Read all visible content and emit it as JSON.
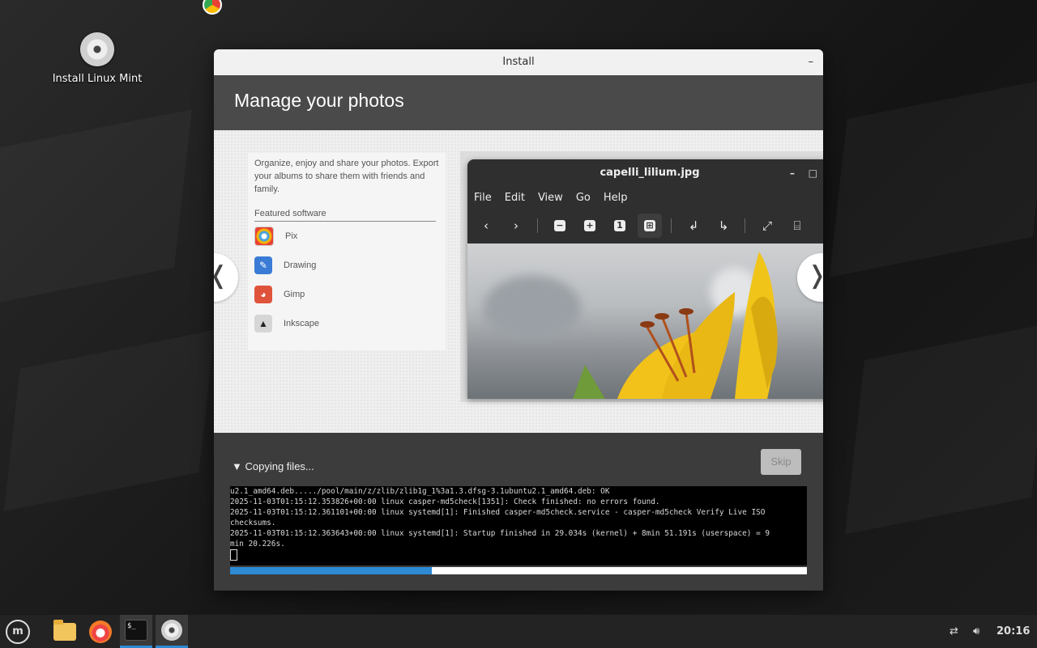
{
  "desktop": {
    "icon_label": "Install Linux Mint"
  },
  "window": {
    "title": "Install",
    "minimize_label": "–",
    "heading": "Manage your photos"
  },
  "slide": {
    "description": "Organize, enjoy and share your photos. Export your albums to share them with friends and family.",
    "featured_title": "Featured software",
    "apps": [
      {
        "name": "Pix",
        "icon": "pix-icon",
        "color": "#f3f3f3"
      },
      {
        "name": "Drawing",
        "icon": "drawing-icon",
        "color": "#3a7bd5"
      },
      {
        "name": "Gimp",
        "icon": "gimp-icon",
        "color": "#e0533b"
      },
      {
        "name": "Inkscape",
        "icon": "inkscape-icon",
        "color": "#d6d6d6"
      }
    ],
    "prev_glyph": "❬",
    "next_glyph": "❭"
  },
  "viewer": {
    "title": "capelli_lilium.jpg",
    "menu": [
      "File",
      "Edit",
      "View",
      "Go",
      "Help"
    ]
  },
  "progress": {
    "label": "Copying files...",
    "skip_label": "Skip",
    "fraction": 0.35,
    "log_lines": [
      "u2.1_amd64.deb...../pool/main/z/zlib/zlib1g_1%3a1.3.dfsg-3.1ubuntu2.1_amd64.deb: OK",
      "2025-11-03T01:15:12.353826+00:00 linux casper-md5check[1351]: Check finished: no errors found.",
      "2025-11-03T01:15:12.361101+00:00 linux systemd[1]: Finished casper-md5check.service - casper-md5check Verify Live ISO",
      "checksums.",
      "2025-11-03T01:15:12.363643+00:00 linux systemd[1]: Startup finished in 29.034s (kernel) + 8min 51.191s (userspace) = 9",
      "min 20.226s."
    ]
  },
  "taskbar": {
    "clock": "20:16",
    "accent": "#2d8ad5"
  }
}
